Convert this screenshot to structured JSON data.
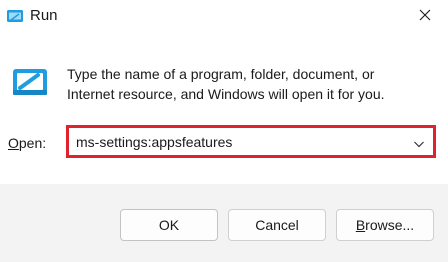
{
  "window": {
    "title": "Run",
    "icons": {
      "app": "run-icon",
      "close": "close-icon",
      "program": "run-program-icon",
      "dropdown": "chevron-down-icon"
    }
  },
  "content": {
    "description_line1": "Type the name of a program, folder, document, or",
    "description_line2": "Internet resource, and Windows will open it for you."
  },
  "open_field": {
    "label_mnemonic": "O",
    "label_rest": "pen:",
    "value": "ms-settings:appsfeatures",
    "highlight_color": "#e0222e"
  },
  "buttons": {
    "ok": "OK",
    "cancel": "Cancel",
    "browse_mnemonic": "B",
    "browse_rest": "rowse..."
  }
}
